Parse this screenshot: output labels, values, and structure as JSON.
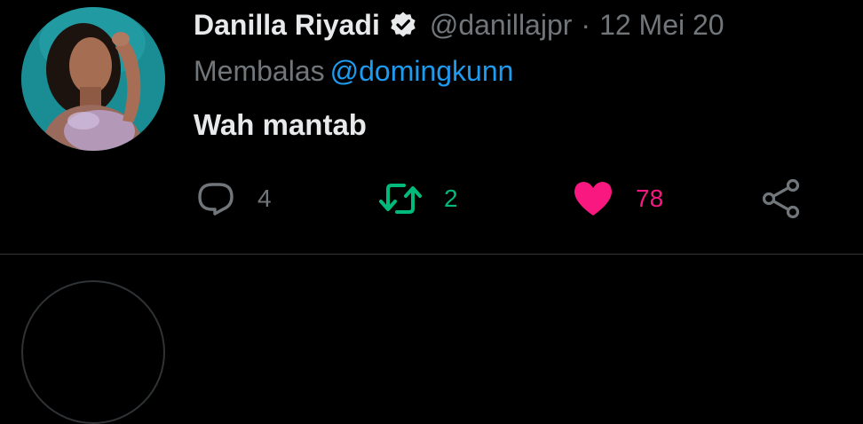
{
  "tweet": {
    "author": {
      "display_name": "Danilla Riyadi",
      "handle": "@danillajpr",
      "verified": true,
      "avatar": "profile-photo"
    },
    "separator": "·",
    "timestamp": "12 Mei 20",
    "reply": {
      "label": "Membalas",
      "mention": "@domingkunn"
    },
    "text": "Wah mantab",
    "actions": {
      "reply": {
        "icon": "reply-bubble-icon",
        "count": "4"
      },
      "retweet": {
        "icon": "retweet-icon",
        "count": "2",
        "active": true
      },
      "like": {
        "icon": "heart-icon",
        "count": "78",
        "active": true
      },
      "share": {
        "icon": "share-icon"
      }
    }
  },
  "colors": {
    "background": "#000000",
    "primary_text": "#e7e9ea",
    "secondary_text": "#71767b",
    "link": "#1d9bf0",
    "retweet_active": "#00ba7c",
    "like_active": "#f91880",
    "divider": "#2f3336"
  }
}
